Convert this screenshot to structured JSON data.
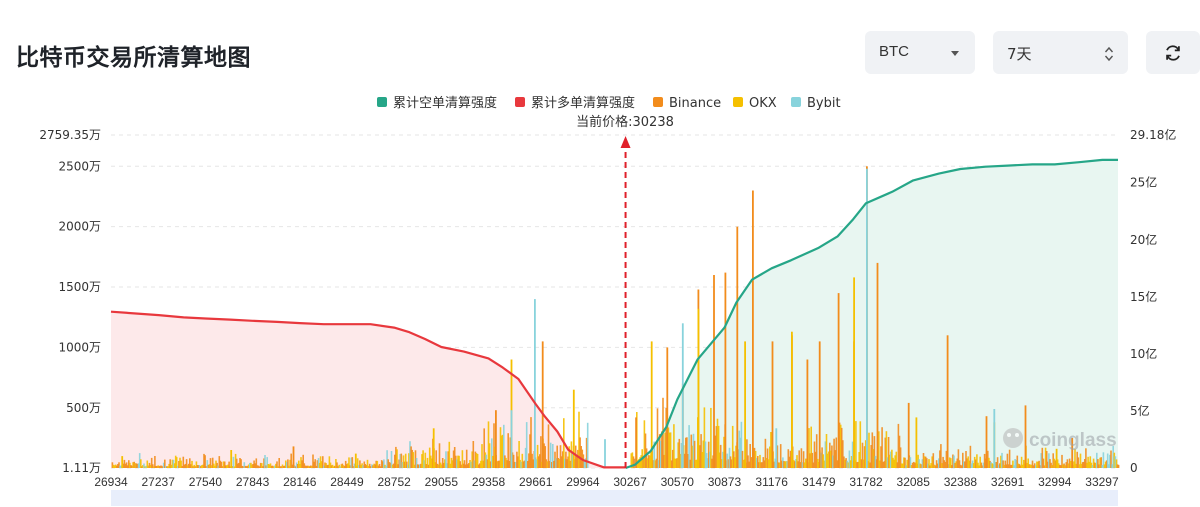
{
  "page": {
    "title": "比特币交易所清算地图",
    "symbol": "BTC",
    "range": "7天"
  },
  "colors": {
    "short_line": "#26a688",
    "short_fill": "#e8f6f1",
    "long_line": "#e8383d",
    "long_fill": "#fde9ea",
    "binance": "#f28c1c",
    "okx": "#f5c000",
    "bybit": "#88d3dc",
    "current_price": "#e0202a"
  },
  "icons": {
    "symbol_caret": "caret-down-icon",
    "range_stepper": "up-down-arrows-icon",
    "refresh": "refresh-icon",
    "watermark": "coinglass-logo"
  },
  "chart_data": {
    "type": "bar",
    "legend": [
      "累计空单清算强度",
      "累计多单清算强度",
      "Binance",
      "OKX",
      "Bybit"
    ],
    "legend_position": "top-center",
    "current_price_label": "当前价格:30238",
    "current_price": 30238,
    "watermark": "coinglass",
    "x_ticks": [
      "26934",
      "27237",
      "27540",
      "27843",
      "28146",
      "28449",
      "28752",
      "29055",
      "29358",
      "29661",
      "29964",
      "30267",
      "30570",
      "30873",
      "31176",
      "31479",
      "31782",
      "32085",
      "32388",
      "32691",
      "32994",
      "33297"
    ],
    "xlim": [
      26934,
      33400
    ],
    "left_axis": {
      "ticks": [
        "1.11万",
        "500万",
        "1000万",
        "1500万",
        "2000万",
        "2500万",
        "2759.35万"
      ],
      "values": [
        1.11,
        500,
        1000,
        1500,
        2000,
        2500,
        2759.35
      ],
      "range": [
        1.11,
        2759.35
      ]
    },
    "right_axis": {
      "ticks": [
        "0",
        "5亿",
        "10亿",
        "15亿",
        "20亿",
        "25亿",
        "29.18亿"
      ],
      "values": [
        0,
        5,
        10,
        15,
        20,
        25,
        29.18
      ],
      "range": [
        0,
        29.18
      ]
    },
    "series": [
      {
        "name": "累计多单清算强度",
        "axis": "right",
        "x": [
          26934,
          27240,
          27400,
          27540,
          27700,
          27843,
          28000,
          28146,
          28300,
          28449,
          28600,
          28752,
          28850,
          28950,
          29055,
          29200,
          29358,
          29450,
          29550,
          29661,
          29720,
          29800,
          29870,
          29964,
          30100,
          30238
        ],
        "values": [
          13.7,
          13.4,
          13.2,
          13.1,
          13.0,
          12.9,
          12.8,
          12.7,
          12.6,
          12.6,
          12.6,
          12.3,
          11.9,
          11.3,
          10.6,
          10.2,
          9.6,
          8.8,
          7.8,
          5.6,
          4.5,
          3.2,
          1.6,
          0.7,
          0.05,
          0.05
        ]
      },
      {
        "name": "累计空单清算强度",
        "axis": "right",
        "x": [
          30238,
          30300,
          30400,
          30500,
          30570,
          30700,
          30873,
          30950,
          31050,
          31176,
          31300,
          31479,
          31600,
          31700,
          31782,
          31950,
          32085,
          32250,
          32388,
          32550,
          32691,
          32850,
          32994,
          33150,
          33300,
          33400
        ],
        "values": [
          0,
          0.3,
          1.5,
          3.6,
          6.0,
          9.5,
          12.3,
          14.5,
          16.5,
          17.5,
          18.2,
          19.3,
          20.3,
          21.8,
          23.2,
          24.2,
          25.2,
          25.8,
          26.2,
          26.4,
          26.5,
          26.6,
          26.6,
          26.8,
          27.0,
          27.0
        ]
      },
      {
        "name": "Binance",
        "axis": "left",
        "x": [
          28100,
          29400,
          29700,
          30300,
          30500,
          30600,
          30700,
          30800,
          30873,
          30950,
          31050,
          31176,
          31300,
          31400,
          31479,
          31600,
          31700,
          31782,
          31850,
          32050,
          32300,
          32550,
          32800,
          33100
        ],
        "values": [
          180,
          480,
          1050,
          420,
          1000,
          700,
          1480,
          1600,
          1620,
          2000,
          2300,
          1050,
          1100,
          900,
          1050,
          1450,
          1050,
          2500,
          1700,
          540,
          1100,
          430,
          520,
          250
        ]
      },
      {
        "name": "OKX",
        "axis": "left",
        "x": [
          27000,
          27700,
          28500,
          29000,
          29500,
          29900,
          30400,
          30700,
          31000,
          31300,
          31700,
          32100,
          32600,
          33000
        ],
        "values": [
          100,
          150,
          120,
          330,
          900,
          650,
          1050,
          1320,
          1050,
          1130,
          1580,
          420,
          380,
          160
        ]
      },
      {
        "name": "Bybit",
        "axis": "left",
        "x": [
          29500,
          29650,
          30100,
          30600,
          31200,
          31782,
          32600
        ],
        "values": [
          480,
          1400,
          240,
          1200,
          330,
          2480,
          490
        ]
      }
    ]
  }
}
